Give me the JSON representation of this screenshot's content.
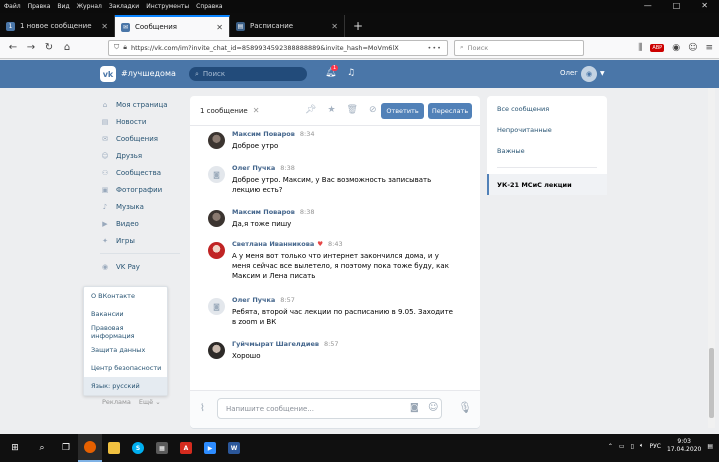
{
  "browser": {
    "menu": [
      "Файл",
      "Правка",
      "Вид",
      "Журнал",
      "Закладки",
      "Инструменты",
      "Справка"
    ],
    "tabs": [
      {
        "label": "1 новое сообщение",
        "badge": "1",
        "active": false
      },
      {
        "label": "Сообщения",
        "active": true
      },
      {
        "label": "Расписание",
        "active": false
      }
    ],
    "url": "https://vk.com/im?invite_chat_id=8589934592388888889&invite_hash=MoVm6lX",
    "search_placeholder": "Поиск",
    "addon_badge": "ABP"
  },
  "header": {
    "hashtag": "#лучшедома",
    "search_placeholder": "Поиск",
    "notifications_count": "1",
    "user_name": "Олег"
  },
  "sidebar": {
    "items": [
      {
        "label": "Моя страница",
        "icon": "home-icon"
      },
      {
        "label": "Новости",
        "icon": "news-icon"
      },
      {
        "label": "Сообщения",
        "icon": "message-icon"
      },
      {
        "label": "Друзья",
        "icon": "friends-icon"
      },
      {
        "label": "Сообщества",
        "icon": "groups-icon"
      },
      {
        "label": "Фотографии",
        "icon": "photo-icon"
      },
      {
        "label": "Музыка",
        "icon": "music-icon"
      },
      {
        "label": "Видео",
        "icon": "video-icon"
      },
      {
        "label": "Игры",
        "icon": "games-icon"
      }
    ],
    "vkpay": "VK Pay",
    "dropdown": [
      "О ВКонтакте",
      "Вакансии",
      "Правовая информация",
      "Защита данных",
      "Центр безопасности",
      "Язык: русский"
    ],
    "footer": {
      "ads": "Реклама",
      "more": "Ещё"
    }
  },
  "chat": {
    "selected": "1 сообщение",
    "reply_label": "Ответить",
    "forward_label": "Переслать",
    "input_placeholder": "Напишите сообщение...",
    "messages": [
      {
        "author": "Максим Поваров",
        "time": "8:34",
        "text": "Доброе утро"
      },
      {
        "author": "Олег Пучка",
        "time": "8:38",
        "text": "Доброе утро. Максим, у Вас возможность записывать лекцию есть?"
      },
      {
        "author": "Максим Поваров",
        "time": "8:38",
        "text": "Да,я тоже пишу"
      },
      {
        "author": "Светлана Иванникова",
        "time": "8:43",
        "text": "А у меня вот только что интернет закончился дома, и у меня сейчас все вылетело, я поэтому пока тоже буду, как Максим и Лена писать"
      },
      {
        "author": "Олег Пучка",
        "time": "8:57",
        "text": "Ребята, второй час лекции по расписанию в 9.05. Заходите в zoom и ВК"
      },
      {
        "author": "Гуйчмырат Шагелдиев",
        "time": "8:57",
        "text": "Хорошо"
      }
    ]
  },
  "filters": {
    "all": "Все сообщения",
    "unread": "Непрочитанные",
    "important": "Важные",
    "chat": "УК-21 МСиС лекции"
  },
  "taskbar": {
    "lang": "РУС",
    "time": "9:03",
    "date": "17.04.2020"
  },
  "colors": {
    "vk_blue": "#4a76a8",
    "button_blue": "#5181b8",
    "link": "#285473"
  }
}
